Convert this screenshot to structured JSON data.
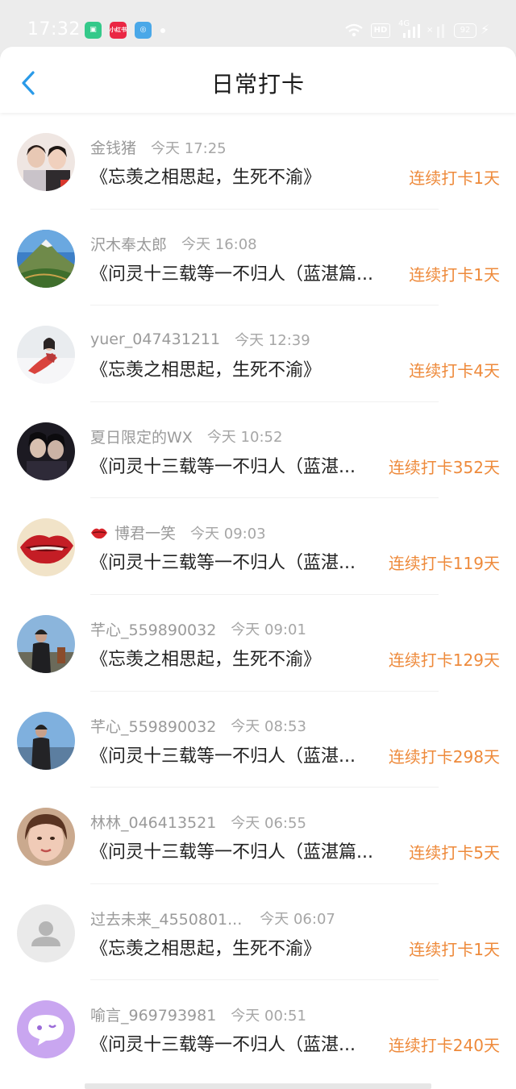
{
  "status_bar": {
    "time": "17:32",
    "apps": [
      {
        "icon": "green-app-icon",
        "color": "#34c98a"
      },
      {
        "icon": "xiaohongshu-icon",
        "label": "小红书",
        "color": "#ea2744"
      },
      {
        "icon": "blue-app-icon",
        "color": "#4aa8e8"
      }
    ],
    "hd": "HD",
    "network": "4G",
    "battery": "92"
  },
  "header": {
    "title": "日常打卡",
    "back_icon": "chevron-left-icon",
    "accent": "#2a9ae8"
  },
  "colors": {
    "streak": "#ee8a3b",
    "name": "#9a9a9a",
    "book": "#222222"
  },
  "checkins": [
    {
      "name": "金钱猪",
      "time": "今天 17:25",
      "book": "《忘羡之相思起，生死不渝》",
      "streak": "连续打卡1天",
      "avatar": "photo-two-women"
    },
    {
      "name": "沢木奉太郎",
      "time": "今天 16:08",
      "book": "《问灵十三载等一不归人（蓝湛篇...",
      "streak": "连续打卡1天",
      "avatar": "photo-mountain"
    },
    {
      "name": "yuer_047431211",
      "time": "今天 12:39",
      "book": "《忘羡之相思起，生死不渝》",
      "streak": "连续打卡4天",
      "avatar": "photo-snow-figure"
    },
    {
      "name": "夏日限定的WX",
      "time": "今天 10:52",
      "book": "《问灵十三载等一不归人（蓝湛...",
      "streak": "连续打卡352天",
      "avatar": "photo-dark-portrait"
    },
    {
      "name": "博君一笑",
      "time": "今天 09:03",
      "book": "《问灵十三载等一不归人（蓝湛...",
      "streak": "连续打卡119天",
      "avatar": "photo-red-lips",
      "badge": "lips-icon"
    },
    {
      "name": "芊心_559890032",
      "time": "今天 09:01",
      "book": "《忘羡之相思起，生死不渝》",
      "streak": "连续打卡129天",
      "avatar": "photo-person-sky"
    },
    {
      "name": "芊心_559890032",
      "time": "今天 08:53",
      "book": "《问灵十三载等一不归人（蓝湛...",
      "streak": "连续打卡298天",
      "avatar": "photo-person-sky"
    },
    {
      "name": "林林_046413521",
      "time": "今天 06:55",
      "book": "《问灵十三载等一不归人（蓝湛篇...",
      "streak": "连续打卡5天",
      "avatar": "photo-woman-face"
    },
    {
      "name": "过去未来_4550801...",
      "time": "今天 06:07",
      "book": "《忘羡之相思起，生死不渝》",
      "streak": "连续打卡1天",
      "avatar": "default-user-icon"
    },
    {
      "name": "喻言_969793981",
      "time": "今天 00:51",
      "book": "《问灵十三载等一不归人（蓝湛...",
      "streak": "连续打卡240天",
      "avatar": "purple-chat-icon"
    }
  ]
}
